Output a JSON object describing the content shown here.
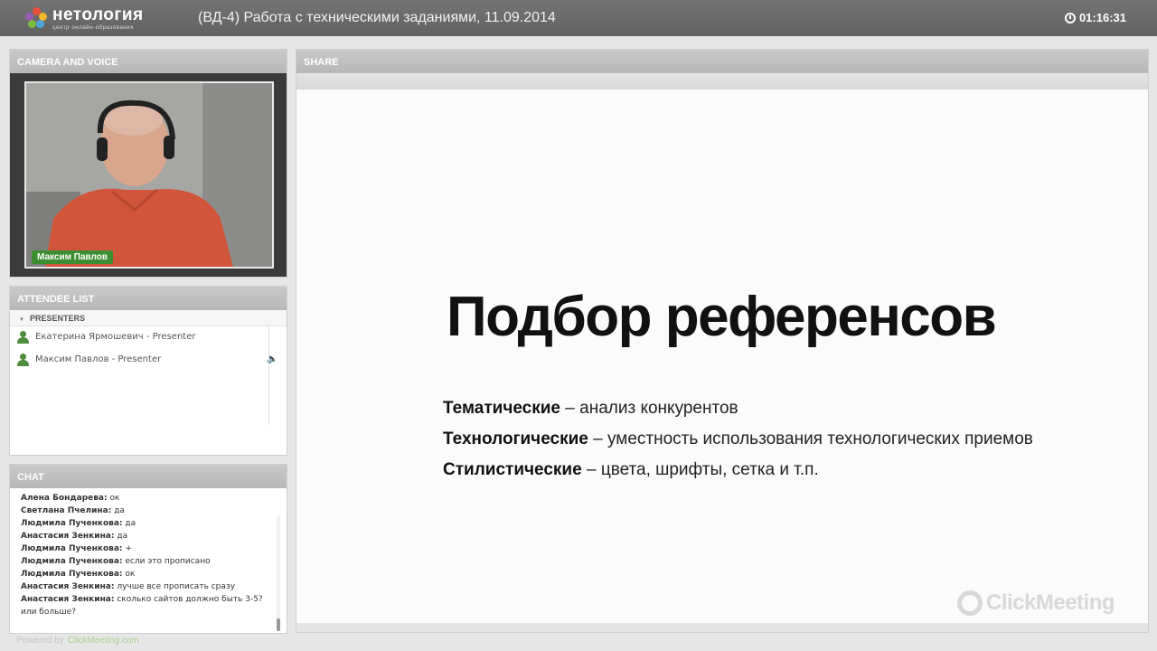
{
  "header": {
    "logo_name": "нетология",
    "logo_sub": "центр онлайн-образования",
    "title": "(ВД-4) Работа с техническими заданиями, 11.09.2014",
    "timer": "01:16:31"
  },
  "camera": {
    "title": "CAMERA AND VOICE",
    "presenter_name": "Максим Павлов"
  },
  "attendees": {
    "title": "ATTENDEE LIST",
    "group": "PRESENTERS",
    "rows": [
      {
        "name": "Екатерина Ярмошевич - Presenter",
        "speaking": false
      },
      {
        "name": "Максим Павлов - Presenter",
        "speaking": true
      }
    ]
  },
  "chat": {
    "title": "CHAT",
    "messages": [
      {
        "who": "Алена Бондарева:",
        "text": "ок"
      },
      {
        "who": "Светлана Пчелина:",
        "text": "да"
      },
      {
        "who": "Людмила Пученкова:",
        "text": "да"
      },
      {
        "who": "Анастасия Зенкина:",
        "text": "да"
      },
      {
        "who": "Людмила Пученкова:",
        "text": "+"
      },
      {
        "who": "Людмила Пученкова:",
        "text": "если это прописано"
      },
      {
        "who": "Людмила Пученкова:",
        "text": "ок"
      },
      {
        "who": "Анастасия Зенкина:",
        "text": "лучше все прописать сразу"
      },
      {
        "who": "Анастасия Зенкина:",
        "text": "сколько сайтов должно быть 3-5? или больше?"
      }
    ]
  },
  "share": {
    "title": "SHARE",
    "slide_title": "Подбор референсов",
    "lines": [
      {
        "bold": "Тематические",
        "rest": "– анализ конкурентов"
      },
      {
        "bold": "Технологические",
        "rest": "– уместность использования технологических приемов"
      },
      {
        "bold": "Стилистические",
        "rest": "– цвета, шрифты, сетка и т.п."
      }
    ],
    "watermark": "ClickMeeting"
  },
  "footer": {
    "prefix": "Powered by",
    "brand": "ClickMeeting.com"
  },
  "colors": {
    "topbar": "#6c6c6c",
    "presenter_green": "#3d8e33",
    "speaking_green": "#4ca742"
  },
  "icons": [
    "logo-flower-icon",
    "clock-icon",
    "person-icon",
    "speaker-icon",
    "collapse-triangle-icon",
    "clickmeeting-logo-icon"
  ]
}
